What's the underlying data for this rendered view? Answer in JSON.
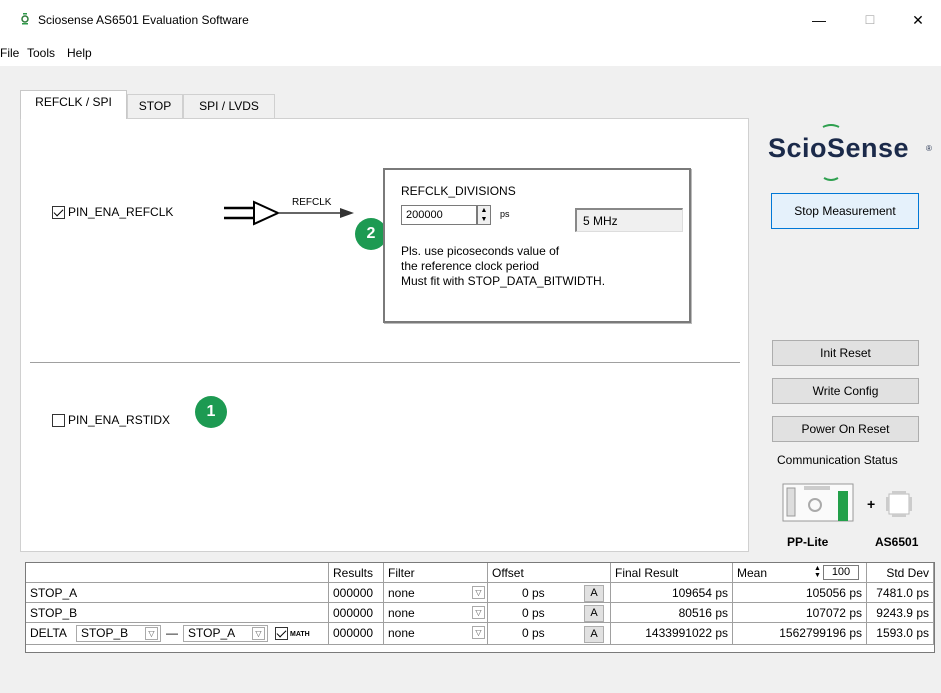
{
  "window": {
    "title": "Sciosense AS6501 Evaluation Software",
    "minimize": "—",
    "maximize": "☐",
    "close": "✕"
  },
  "menu": [
    "File",
    "Tools",
    "Help"
  ],
  "tabs": [
    "REFCLK / SPI",
    "STOP",
    "SPI / LVDS"
  ],
  "refclk": {
    "enable_label": "PIN_ENA_REFCLK",
    "enable_checked": true,
    "arrow_label": "REFCLK",
    "badge_2": "2",
    "box_title": "REFCLK_DIVISIONS",
    "divisions_value": "200000",
    "unit": "ps",
    "frequency": "5 MHz",
    "note_lines": [
      "Pls. use picoseconds value of",
      "the reference clock period",
      "Must fit with STOP_DATA_BITWIDTH."
    ]
  },
  "rstidx": {
    "label": "PIN_ENA_RSTIDX",
    "checked": false,
    "badge_1": "1"
  },
  "sidebar": {
    "logo": "ScioSense",
    "stop_button": "Stop Measurement",
    "init_reset": "Init Reset",
    "write_config": "Write Config",
    "power_on_reset": "Power On Reset",
    "comm_status": "Communication Status",
    "board_left": "PP-Lite",
    "board_right": "AS6501",
    "plus": "+"
  },
  "grid": {
    "headers": {
      "results": "Results",
      "filter": "Filter",
      "offset": "Offset",
      "final": "Final Result",
      "mean": "Mean",
      "mean_count": "100",
      "std": "Std Dev"
    },
    "rows": [
      {
        "name": "STOP_A",
        "results": "000000",
        "filter": "none",
        "offset": "0 ps",
        "a": "A",
        "final": "109654 ps",
        "mean": "105056 ps",
        "std": "7481.0 ps"
      },
      {
        "name": "STOP_B",
        "results": "000000",
        "filter": "none",
        "offset": "0 ps",
        "a": "A",
        "final": "80516 ps",
        "mean": "107072 ps",
        "std": "9243.9 ps"
      },
      {
        "name": "DELTA",
        "results": "000000",
        "filter": "none",
        "offset": "0 ps",
        "a": "A",
        "final": "1433991022 ps",
        "mean": "1562799196 ps",
        "std": "1593.0 ps"
      }
    ],
    "delta": {
      "left": "STOP_B",
      "dash": "—",
      "right": "STOP_A",
      "math": "MATH"
    }
  }
}
